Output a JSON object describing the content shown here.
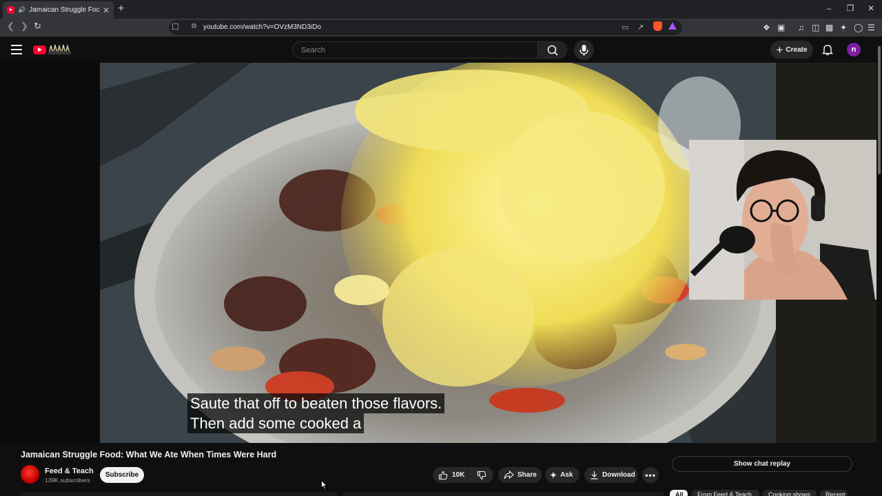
{
  "browser": {
    "tab_title": "Jamaican Struggle Food: Wha",
    "url": "youtube.com/watch?v=OVzM3ND3iDo"
  },
  "header": {
    "search_placeholder": "Search",
    "create_label": "Create",
    "account_initial": "n"
  },
  "player": {
    "caption_line1": "Saute that off to beaten those flavors.",
    "caption_line2": "Then add some cooked a"
  },
  "video": {
    "title": "Jamaican Struggle Food: What We Ate When Times Were Hard",
    "channel_name": "Feed & Teach",
    "subscriber_count": "139K subscribers",
    "subscribe_label": "Subscribe",
    "like_count": "10K",
    "share_label": "Share",
    "ask_label": "Ask",
    "download_label": "Download"
  },
  "sidebar": {
    "chat_replay_label": "Show chat replay",
    "chips": [
      "All",
      "From Feed & Teach",
      "Cooking shows",
      "Recent"
    ]
  },
  "colors": {
    "brand_red": "#ff0033",
    "background": "#0f0f0f",
    "account_purple": "#7b1fa2"
  }
}
